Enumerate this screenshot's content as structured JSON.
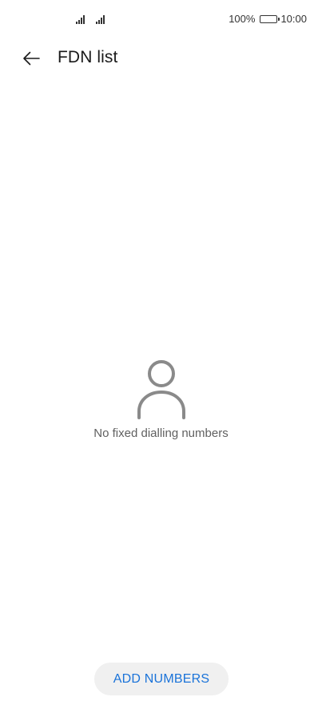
{
  "status_bar": {
    "battery_percent": "100%",
    "time": "10:00",
    "icons": [
      "signal-icon",
      "signal-icon",
      "battery-icon"
    ]
  },
  "app_bar": {
    "title": "FDN list",
    "back_icon": "back-arrow-icon"
  },
  "empty_state": {
    "icon": "person-icon",
    "message": "No fixed dialling numbers"
  },
  "actions": {
    "add_numbers_label": "ADD NUMBERS"
  },
  "colors": {
    "accent": "#1a73d9",
    "button_bg": "#f0f0f0",
    "icon_gray": "#8a8a8a"
  }
}
